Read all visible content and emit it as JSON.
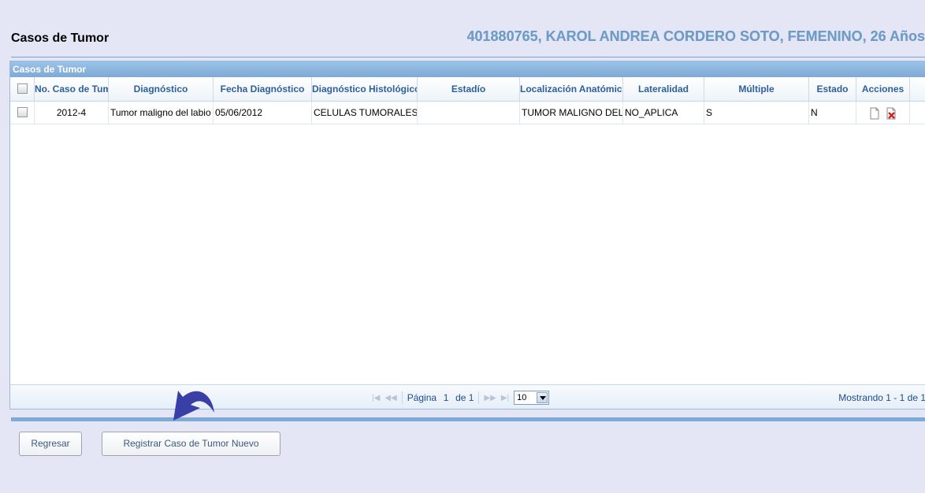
{
  "header": {
    "title": "Casos de Tumor",
    "patient_info": "401880765, KAROL ANDREA CORDERO SOTO, FEMENINO, 26 Años"
  },
  "grid": {
    "caption": "Casos de Tumor",
    "columns": [
      "No. Caso de Tumor",
      "Diagnóstico",
      "Fecha Diagnóstico",
      "Diagnóstico Histológico",
      "Estadío",
      "Localización Anatómica",
      "Lateralidad",
      "Múltiple",
      "Estado",
      "Acciones"
    ],
    "rows": [
      {
        "case_no": "2012-4",
        "diagnosis": "Tumor maligno del labio",
        "date": "05/06/2012",
        "histology": "CELULAS TUMORALES",
        "stage": "",
        "location": "TUMOR MALIGNO DEL",
        "laterality": "NO_APLICA",
        "multiple": "S",
        "status": "N",
        "actions": [
          "view-document-icon",
          "delete-document-icon"
        ]
      }
    ]
  },
  "pager": {
    "page_label": "Página",
    "page_value": "1",
    "of_label": "de 1",
    "page_size": "10",
    "record_info": "Mostrando 1 - 1 de 1"
  },
  "buttons": {
    "back": "Regresar",
    "new_case": "Registrar Caso de Tumor Nuevo"
  },
  "colors": {
    "background": "#e4e6f6",
    "caption_bar": "#7fa9d6",
    "header_text": "#2b5f9e",
    "patient_info": "#6f9bc7",
    "annotation_arrow": "#3a3fa8"
  }
}
